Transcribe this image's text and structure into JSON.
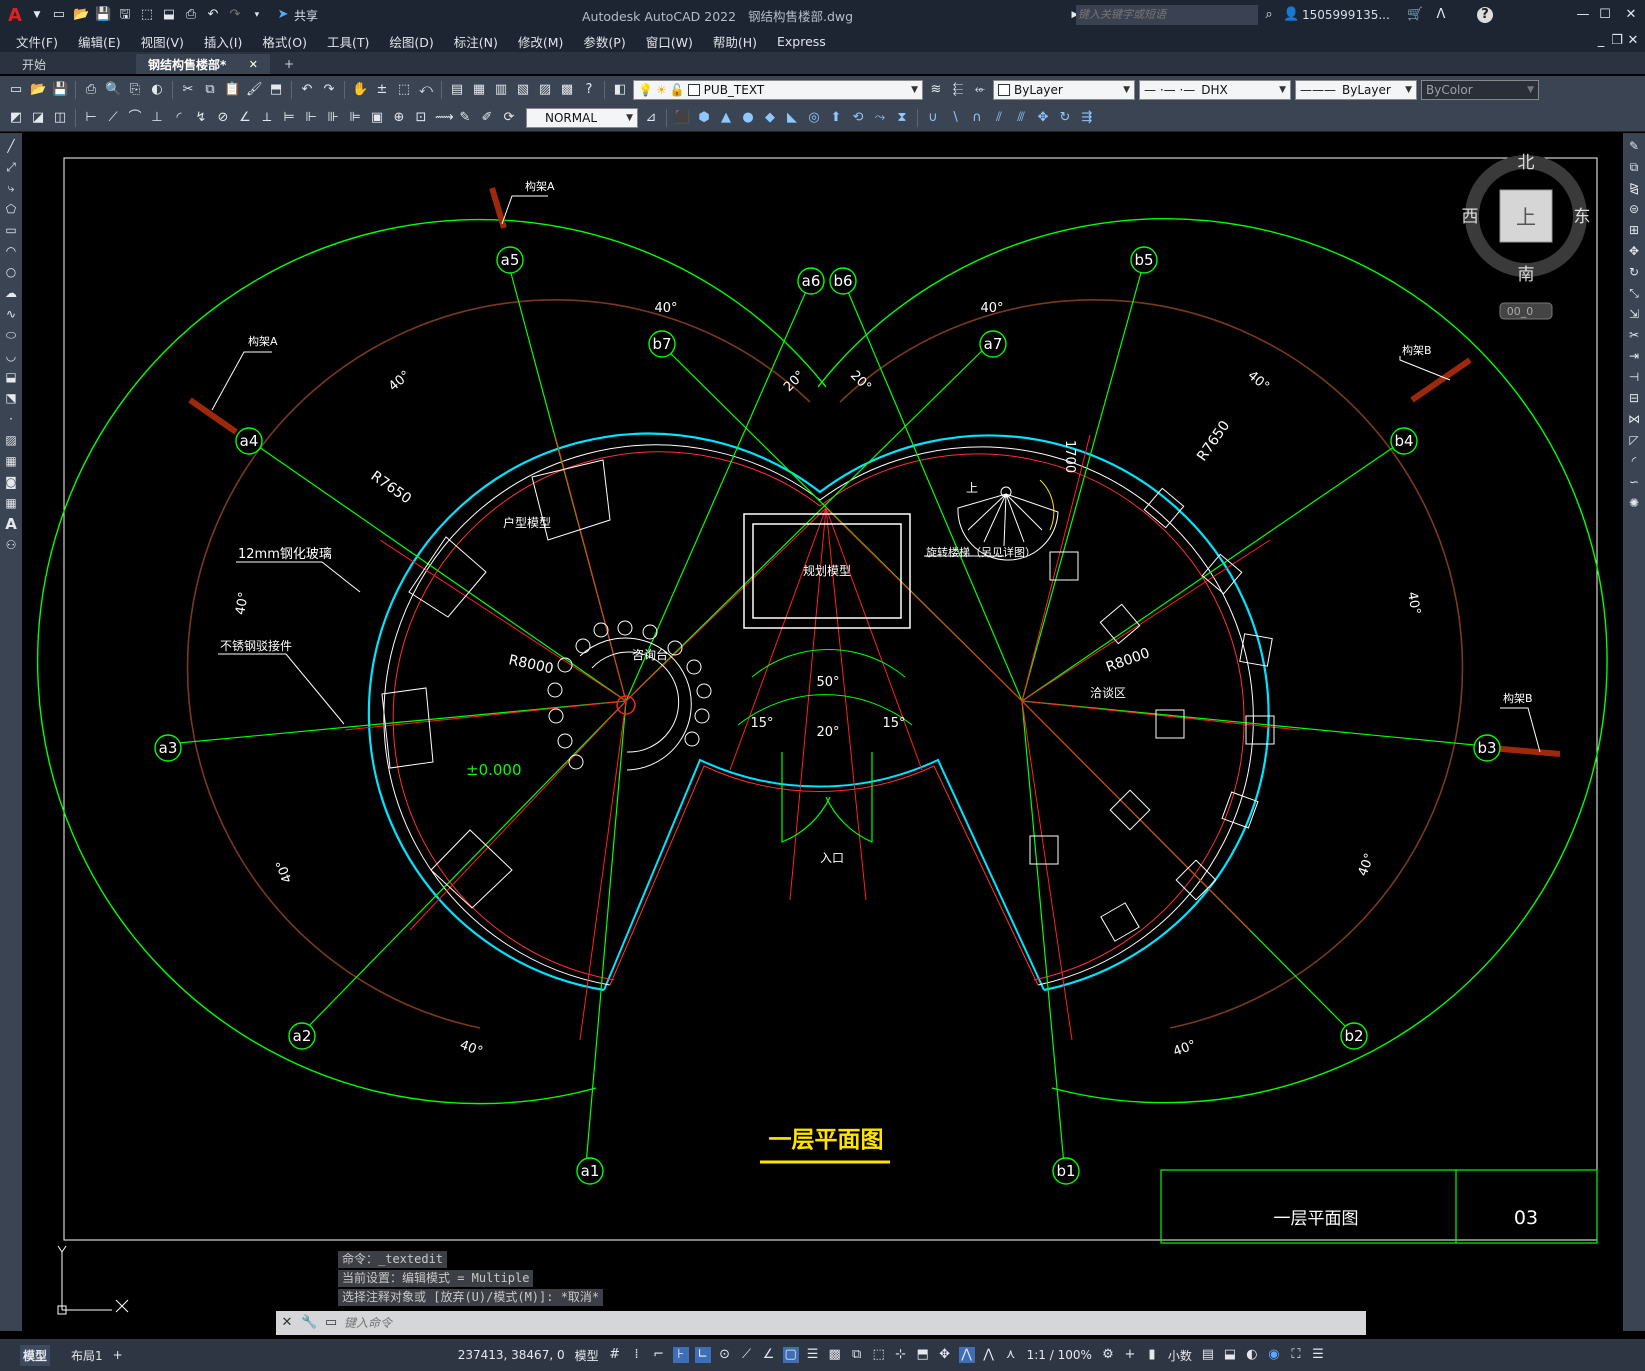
{
  "app": {
    "title": "Autodesk AutoCAD 2022",
    "file": "钢结构售楼部.dwg",
    "share_label": "共享",
    "search_placeholder": "键入关键字或短语",
    "user": "1505999135...",
    "app_logo_letter": "A"
  },
  "menu": [
    "文件(F)",
    "编辑(E)",
    "视图(V)",
    "插入(I)",
    "格式(O)",
    "工具(T)",
    "绘图(D)",
    "标注(N)",
    "修改(M)",
    "参数(P)",
    "窗口(W)",
    "帮助(H)",
    "Express"
  ],
  "tabs": {
    "start": "开始",
    "drawing": "钢结构售楼部*",
    "close": "✕",
    "add": "+"
  },
  "toolbar1": {
    "layer": "PUB_TEXT",
    "color": "ByLayer",
    "linetype": "DHX",
    "lineweight": "ByLayer",
    "plotstyle": "ByColor"
  },
  "toolbar2": {
    "dimstyle": "NORMAL"
  },
  "viewcube": {
    "north": "北",
    "south": "南",
    "east": "东",
    "west": "西",
    "top": "上",
    "wcs": "00_0"
  },
  "drawing": {
    "title": "一层平面图",
    "titleblock_name": "一层平面图",
    "titleblock_number": "03",
    "axes": [
      "a1",
      "a2",
      "a3",
      "a4",
      "a5",
      "a6",
      "a7",
      "b1",
      "b2",
      "b3",
      "b4",
      "b5",
      "b6",
      "b7"
    ],
    "angles": [
      "40°",
      "40°",
      "40°",
      "40°",
      "40°",
      "40°",
      "40°",
      "40°",
      "40°",
      "40°",
      "20°",
      "20°",
      "50°",
      "15°",
      "20°",
      "15°"
    ],
    "radii": [
      "R7650",
      "R8000",
      "R7650",
      "R8000"
    ],
    "labels": {
      "truss_a1": "构架A",
      "truss_a2": "构架A",
      "truss_b1": "构架B",
      "truss_b2": "构架B",
      "glass": "12mm钢化玻璃",
      "steel": "不锈钢驳接件",
      "model_house": "户型模型",
      "planning_model": "规划模型",
      "reception": "咨询台",
      "stair": "旋转楼梯（另见详图）",
      "stair_up": "上",
      "negotiation": "洽谈区",
      "entrance": "入口",
      "level": "±0.000",
      "dim_1700": "1700"
    }
  },
  "command": {
    "history": [
      "命令：_textedit",
      "当前设置：编辑模式 = Multiple",
      "选择注释对象或 [放弃(U)/模式(M)]: *取消*"
    ],
    "placeholder": "键入命令"
  },
  "status": {
    "model_tab": "模型",
    "layout_tab": "布局1",
    "add": "+",
    "coords": "237413, 38467, 0",
    "space": "模型",
    "scale": "1:1 / 100%",
    "units": "小数"
  },
  "colors": {
    "accent_green": "#00ff00",
    "cyan": "#00e5ff",
    "red": "#ff2020",
    "yellow": "#ffe400",
    "brown": "#7a3a1a"
  }
}
